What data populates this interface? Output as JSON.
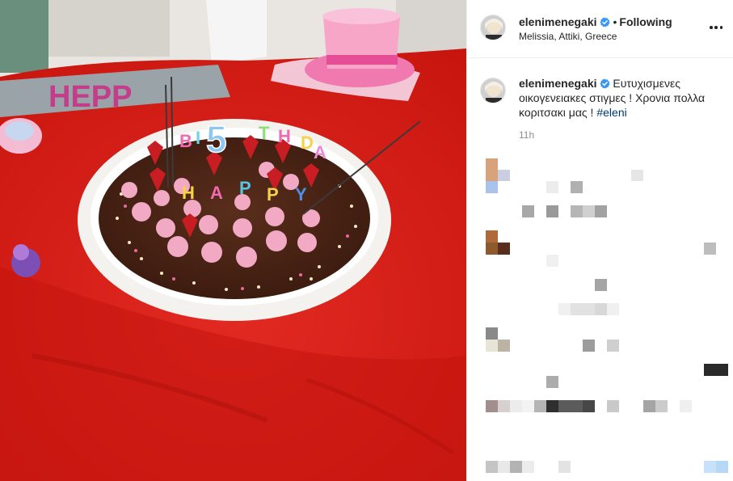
{
  "post": {
    "username": "elenimenegaki",
    "verified_icon": "verified-badge-icon",
    "separator": "•",
    "follow_status": "Following",
    "location": "Melissia, Attiki, Greece",
    "more_icon": "more-options-icon"
  },
  "caption": {
    "username": "elenimenegaki",
    "text": "Ευτυχισμενες οικογενειακες στιγμες ! Χρονια πολλα κοριτσακι μας !",
    "hashtag": "#eleni",
    "time": "11h"
  },
  "photo": {
    "description_icon": "birthday-cake-photo",
    "candle_number": "5",
    "banner_letters": "HEPP"
  },
  "colors": {
    "accent_blue": "#3897f0",
    "hashtag": "#00376b",
    "tablecloth": "#d9201c",
    "muted": "#8e8e8e"
  }
}
